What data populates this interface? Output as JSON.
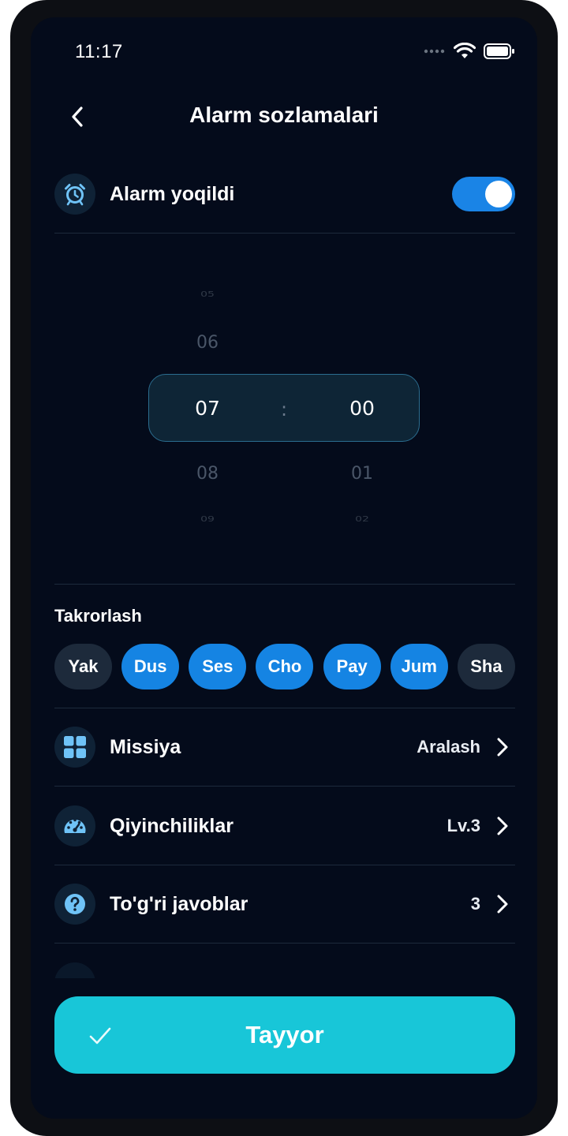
{
  "status_bar": {
    "time": "11:17",
    "icons": [
      "signal-dots-icon",
      "wifi-icon",
      "battery-icon"
    ]
  },
  "header": {
    "title": "Alarm sozlamalari",
    "back_icon": "chevron-left-icon"
  },
  "alarm_toggle": {
    "label": "Alarm yoqildi",
    "icon": "alarm-clock-icon",
    "enabled": true
  },
  "time_picker": {
    "hours": [
      "05",
      "06",
      "07",
      "08",
      "09"
    ],
    "minutes": [
      "01",
      "02"
    ],
    "selected_hour": "07",
    "selected_minute": "00",
    "separator": ":"
  },
  "repeat": {
    "label": "Takrorlash",
    "days": [
      {
        "label": "Yak",
        "active": false
      },
      {
        "label": "Dus",
        "active": true
      },
      {
        "label": "Ses",
        "active": true
      },
      {
        "label": "Cho",
        "active": true
      },
      {
        "label": "Pay",
        "active": true
      },
      {
        "label": "Jum",
        "active": true
      },
      {
        "label": "Sha",
        "active": false
      }
    ]
  },
  "settings": [
    {
      "label": "Missiya",
      "value": "Aralash",
      "icon": "grid-icon"
    },
    {
      "label": "Qiyinchiliklar",
      "value": "Lv.3",
      "icon": "speedometer-icon"
    },
    {
      "label": "To'g'ri javoblar",
      "value": "3",
      "icon": "question-circle-icon"
    }
  ],
  "done_button": {
    "label": "Tayyor",
    "icon": "check-icon"
  },
  "colors": {
    "background": "#040b1b",
    "accent_blue": "#1584e3",
    "accent_cyan": "#18c6d8",
    "icon_light_blue": "#6fc3f7",
    "inactive_chip": "#1d2a3b"
  }
}
